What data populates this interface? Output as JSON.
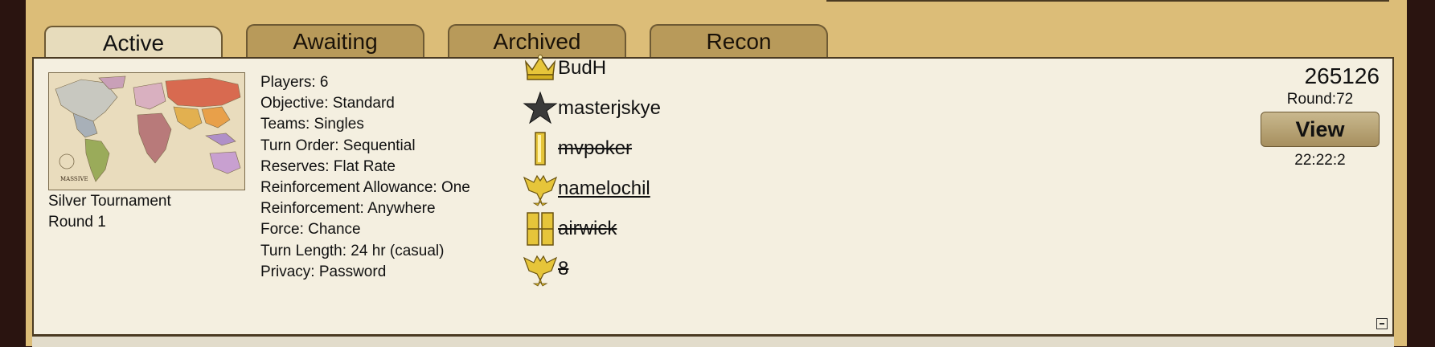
{
  "tabs": [
    {
      "label": "Active",
      "active": true
    },
    {
      "label": "Awaiting",
      "active": false
    },
    {
      "label": "Archived",
      "active": false
    },
    {
      "label": "Recon",
      "active": false
    }
  ],
  "game": {
    "map_caption_line1": "Silver Tournament",
    "map_caption_line2": "Round 1",
    "map_logo": "MASSIVE",
    "settings": [
      "Players: 6",
      "Objective: Standard",
      "Teams: Singles",
      "Turn Order: Sequential",
      "Reserves: Flat Rate",
      "Reinforcement Allowance: One",
      "Reinforcement: Anywhere",
      "Force: Chance",
      "Turn Length: 24 hr (casual)",
      "Privacy: Password"
    ],
    "players": [
      {
        "name": "BudH",
        "rank_icon": "crown-icon",
        "style": "normal"
      },
      {
        "name": "masterjskye",
        "rank_icon": "star-icon",
        "style": "normal"
      },
      {
        "name": "mvpoker",
        "rank_icon": "single-bar-icon",
        "style": "strike"
      },
      {
        "name": "namelochil",
        "rank_icon": "eagle-icon",
        "style": "underline"
      },
      {
        "name": "airwick",
        "rank_icon": "double-bar-icon",
        "style": "strike"
      },
      {
        "name": "8",
        "rank_icon": "eagle-icon",
        "style": "strike"
      }
    ],
    "game_id": "265126",
    "round": "Round:72",
    "view_label": "View",
    "timer": "22:22:2"
  },
  "colors": {
    "frame": "#dcbd78",
    "tab_inactive": "#b89a5a",
    "tab_active": "#e7dcbc",
    "panel": "#f4efe0",
    "gold": "#d4b020"
  }
}
